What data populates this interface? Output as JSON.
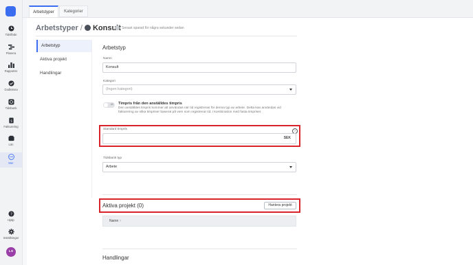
{
  "app": {
    "rail": [
      {
        "label": "Tidsflöde",
        "icon": "clock-icon"
      },
      {
        "label": "Planera",
        "icon": "plan-icon"
      },
      {
        "label": "Rapporter",
        "icon": "bar-chart-icon"
      },
      {
        "label": "Godkänna",
        "icon": "check-circle-icon"
      },
      {
        "label": "Tidsbank",
        "icon": "timebank-icon"
      },
      {
        "label": "Fakturering",
        "icon": "invoice-icon"
      },
      {
        "label": "Lön",
        "icon": "wallet-icon"
      },
      {
        "label": "Mer",
        "icon": "more-icon"
      },
      {
        "label": "Hjälp",
        "icon": "help-icon"
      },
      {
        "label": "Inställningar",
        "icon": "gear-icon"
      }
    ],
    "avatar_initials": "LS",
    "accent": "#3b6df0",
    "highlight": "#d8232a"
  },
  "tabs": [
    {
      "label": "Arbetstyper",
      "active": true
    },
    {
      "label": "Kategorier",
      "active": false
    }
  ],
  "header": {
    "breadcrumb": "Arbetstyper",
    "separator": "/",
    "title": "Konsult",
    "saved_text": "Senast sparad för några sekunder sedan"
  },
  "sidenav": [
    {
      "label": "Arbetstyp",
      "active": true
    },
    {
      "label": "Aktiva projekt",
      "active": false
    },
    {
      "label": "Handlingar",
      "active": false
    }
  ],
  "form": {
    "section_title": "Arbetstyp",
    "name": {
      "label": "Namn",
      "value": "Konsult"
    },
    "category": {
      "label": "Kategori",
      "placeholder": "(Ingen kategori)"
    },
    "toggle": {
      "state_text": "AV",
      "title": "Timpris från den anställdes timpris",
      "description": "Den anställdes timpris kommer att användas när tid registreras för denna typ av arbete. Detta kan användas vid fakturering av olika timpriser baserat på vem som registrerar tid, i kombination med fasta timpriser."
    },
    "standard_rate": {
      "label": "Standard timpris",
      "value": "",
      "suffix": "SEK",
      "info": "?"
    },
    "timebank": {
      "label": "Tidsbank typ",
      "value": "Arbete"
    }
  },
  "projects": {
    "title": "Aktiva projekt (0)",
    "manage_button": "Hantera projekt",
    "table_header": "Namn ↑"
  },
  "documents": {
    "title": "Handlingar"
  }
}
